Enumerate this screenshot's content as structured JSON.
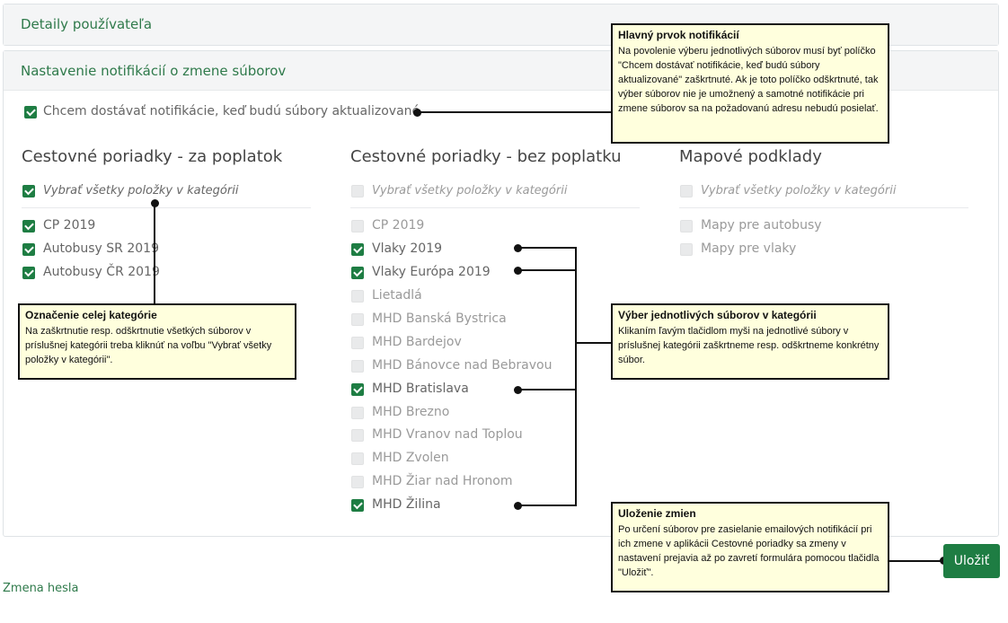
{
  "user_panel": {
    "title": "Detaily používateľa"
  },
  "notif_panel": {
    "title": "Nastavenie notifikácií o zmene súborov"
  },
  "main_checkbox": {
    "label": "Chcem dostávať notifikácie, keď budú súbory aktualizované",
    "checked": true
  },
  "categories": [
    {
      "title": "Cestovné poriadky - za poplatok",
      "select_all": {
        "label": "Vybrať všetky položky v kategórii",
        "checked": true
      },
      "items": [
        {
          "label": "CP 2019",
          "checked": true
        },
        {
          "label": "Autobusy SR 2019",
          "checked": true
        },
        {
          "label": "Autobusy ČR 2019",
          "checked": true
        }
      ]
    },
    {
      "title": "Cestovné poriadky - bez poplatku",
      "select_all": {
        "label": "Vybrať všetky položky v kategórii",
        "checked": false
      },
      "items": [
        {
          "label": "CP 2019",
          "checked": false
        },
        {
          "label": "Vlaky 2019",
          "checked": true
        },
        {
          "label": "Vlaky Európa 2019",
          "checked": true
        },
        {
          "label": "Lietadlá",
          "checked": false
        },
        {
          "label": "MHD Banská Bystrica",
          "checked": false
        },
        {
          "label": "MHD Bardejov",
          "checked": false
        },
        {
          "label": "MHD Bánovce nad Bebravou",
          "checked": false
        },
        {
          "label": "MHD Bratislava",
          "checked": true
        },
        {
          "label": "MHD Brezno",
          "checked": false
        },
        {
          "label": "MHD Vranov nad Toplou",
          "checked": false
        },
        {
          "label": "MHD Zvolen",
          "checked": false
        },
        {
          "label": "MHD Žiar nad Hronom",
          "checked": false
        },
        {
          "label": "MHD Žilina",
          "checked": true
        }
      ]
    },
    {
      "title": "Mapové podklady",
      "select_all": {
        "label": "Vybrať všetky položky v kategórii",
        "checked": false
      },
      "items": [
        {
          "label": "Mapy pre autobusy",
          "checked": false
        },
        {
          "label": "Mapy pre vlaky",
          "checked": false
        }
      ]
    }
  ],
  "callouts": {
    "main": {
      "title": "Hlavný prvok notifikácií",
      "text": "Na povolenie výberu jednotlivých súborov musí byť políčko \"Chcem dostávať notifikácie, keď budú súbory aktualizované\" zaškrtnuté. Ak je toto políčko odškrtnuté, tak výber súborov nie je umožnený a samotné notifikácie pri zmene súborov sa na požadovanú adresu nebudú posielať."
    },
    "category": {
      "title": "Označenie celej kategórie",
      "text": "Na zaškrtnutie resp. odškrtnutie všetkých súborov v príslušnej kategórii treba kliknúť na voľbu \"Vybrať všetky položky v kategórii\"."
    },
    "items": {
      "title": "Výber jednotlivých súborov v kategórii",
      "text": "Klikaním ľavým tlačidlom myši na jednotlivé súbory v príslušnej kategórii zaškrtneme resp. odškrtneme konkrétny súbor."
    },
    "save": {
      "title": "Uloženie zmien",
      "text": "Po určení súborov pre zasielanie emailových notifikácií pri ich zmene v aplikácii Cestovné poriadky sa zmeny  v nastavení prejavia až po zavretí formulára pomocou tlačidla \"Uložiť\"."
    }
  },
  "save_button": {
    "label": "Uložiť"
  },
  "password_link": {
    "label": "Zmena hesla"
  }
}
